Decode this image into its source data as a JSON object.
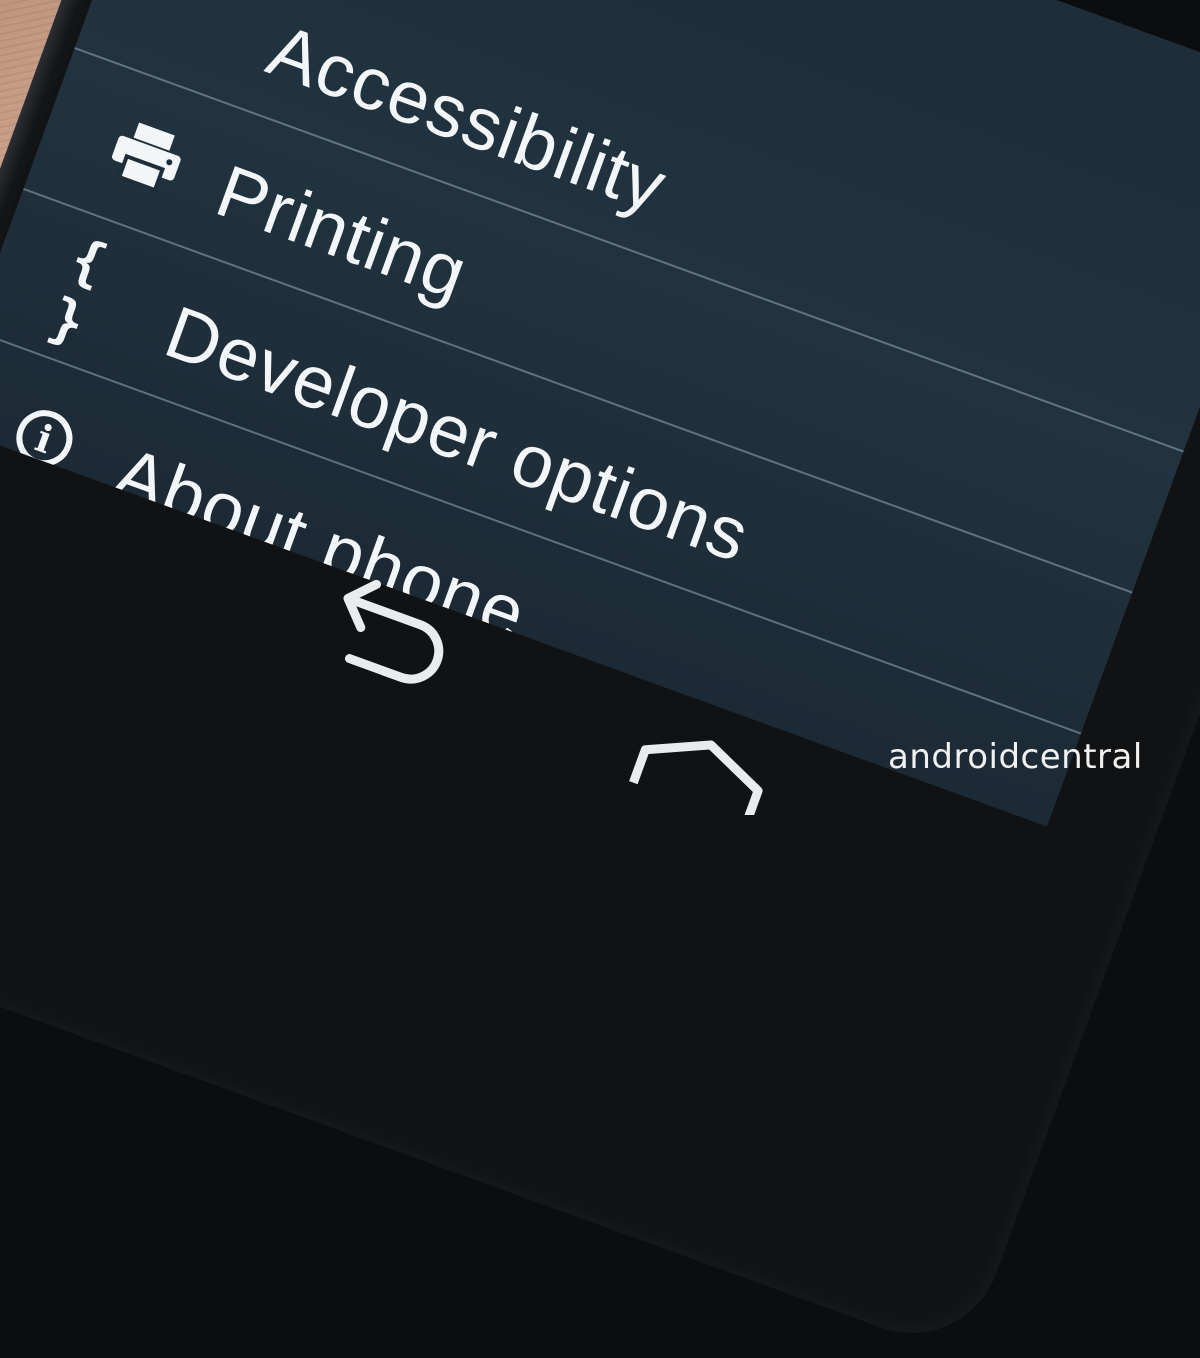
{
  "settings_list": {
    "items": [
      {
        "label": "Accessibility",
        "icon": "accessibility-icon"
      },
      {
        "label": "Printing",
        "icon": "printer-icon"
      },
      {
        "label": "Developer options",
        "icon": "braces-icon",
        "icon_text": "{ }"
      },
      {
        "label": "About phone",
        "icon": "info-icon",
        "icon_text": "i"
      }
    ]
  },
  "nav_bar": {
    "back": {
      "icon": "back-arrow-icon"
    },
    "home": {
      "icon": "home-icon"
    }
  },
  "watermark": {
    "text": "androidcentral"
  },
  "colors": {
    "screen_background": "#1d2d39",
    "text": "#f3f6f8",
    "divider": "#96aab9",
    "bezel": "#101214"
  }
}
